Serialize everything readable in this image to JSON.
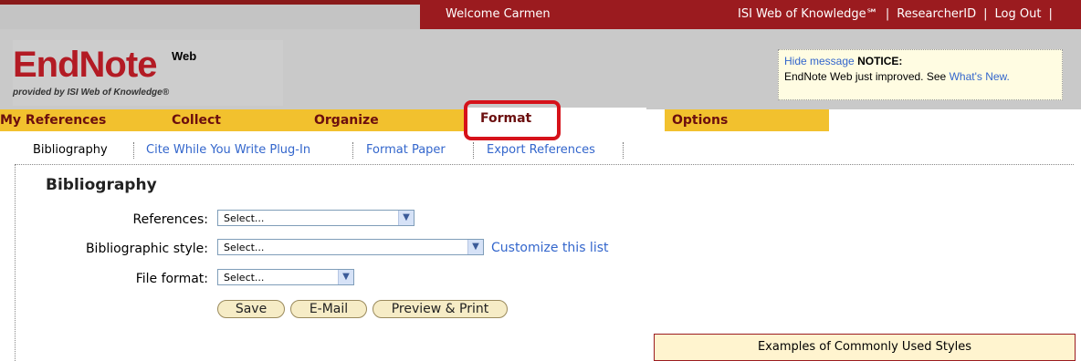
{
  "topbar": {
    "welcome": "Welcome Carmen",
    "links": [
      "ISI Web of Knowledge℠",
      "ResearcherID",
      "Log Out"
    ]
  },
  "logo": {
    "main": "EndNote",
    "superscript": "Web",
    "subtitle": "provided by ISI Web of Knowledge®"
  },
  "notice": {
    "hide": "Hide message",
    "title": "NOTICE:",
    "text": "EndNote Web just improved. See",
    "link": "What's New."
  },
  "tabs": [
    "My References",
    "Collect",
    "Organize",
    "Format",
    "Options"
  ],
  "subnav": [
    "Bibliography",
    "Cite While You Write Plug-In",
    "Format Paper",
    "Export References"
  ],
  "page": {
    "heading": "Bibliography"
  },
  "form": {
    "references_label": "References:",
    "references_value": "Select...",
    "style_label": "Bibliographic style:",
    "style_value": "Select...",
    "customize": "Customize this list",
    "format_label": "File format:",
    "format_value": "Select..."
  },
  "buttons": {
    "save": "Save",
    "email": "E-Mail",
    "preview": "Preview & Print"
  },
  "examples": "Examples of Commonly Used Styles",
  "colors": {
    "brand_red": "#9b1b1f",
    "tab_yellow": "#f2c12e",
    "highlight": "#d6121a",
    "link": "#3366cc"
  }
}
